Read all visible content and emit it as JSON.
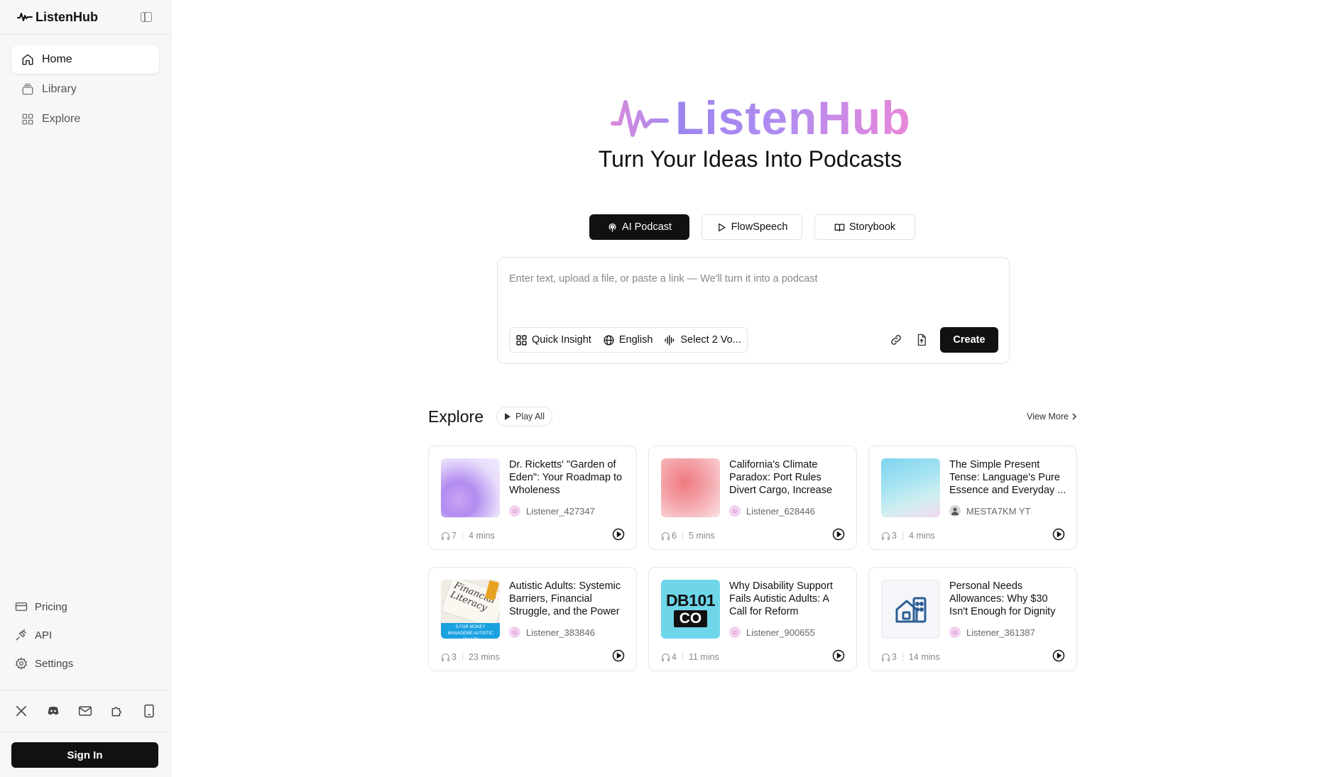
{
  "app": {
    "name": "ListenHub"
  },
  "sidebar": {
    "nav": [
      {
        "label": "Home",
        "icon": "home-icon",
        "active": true
      },
      {
        "label": "Library",
        "icon": "library-icon",
        "active": false
      },
      {
        "label": "Explore",
        "icon": "grid-icon",
        "active": false
      }
    ],
    "bottom": [
      {
        "label": "Pricing",
        "icon": "card-icon"
      },
      {
        "label": "API",
        "icon": "plug-icon"
      },
      {
        "label": "Settings",
        "icon": "gear-icon"
      }
    ],
    "socials": [
      "x-icon",
      "discord-icon",
      "mail-icon",
      "puzzle-icon",
      "tablet-icon"
    ],
    "sign_in": "Sign In"
  },
  "hero": {
    "logo_text": "ListenHub",
    "title": "Turn Your Ideas Into Podcasts"
  },
  "modes": [
    {
      "label": "AI Podcast",
      "icon": "podcast-icon",
      "active": true
    },
    {
      "label": "FlowSpeech",
      "icon": "play-icon",
      "active": false
    },
    {
      "label": "Storybook",
      "icon": "book-icon",
      "active": false
    }
  ],
  "composer": {
    "placeholder": "Enter text, upload a file, or paste a link — We'll turn it into a podcast",
    "options": [
      {
        "label": "Quick Insight",
        "icon": "grid-icon"
      },
      {
        "label": "English",
        "icon": "globe-icon"
      },
      {
        "label": "Select 2 Vo...",
        "icon": "waveform-icon"
      }
    ],
    "create": "Create"
  },
  "explore": {
    "title": "Explore",
    "play_all": "Play All",
    "view_more": "View More",
    "cards": [
      {
        "title": "Dr. Ricketts' \"Garden of Eden\": Your Roadmap to Wholeness",
        "author": "Listener_427347",
        "listens": "7",
        "duration": "4 mins",
        "thumb": "purple"
      },
      {
        "title": "California's Climate Paradox: Port Rules Divert Cargo, Increase GHG ...",
        "author": "Listener_628446",
        "listens": "6",
        "duration": "5 mins",
        "thumb": "red"
      },
      {
        "title": "The Simple Present Tense: Language's Pure Essence and Everyday ...",
        "author": "MESTA7KM YT",
        "listens": "3",
        "duration": "4 mins",
        "thumb": "blue"
      },
      {
        "title": "Autistic Adults: Systemic Barriers, Financial Struggle, and the Power ...",
        "author": "Listener_383846",
        "listens": "3",
        "duration": "23 mins",
        "thumb": "literacy"
      },
      {
        "title": "Why Disability Support Fails Autistic Adults: A Call for Reform",
        "author": "Listener_900655",
        "listens": "4",
        "duration": "11 mins",
        "thumb": "db101"
      },
      {
        "title": "Personal Needs Allowances: Why $30 Isn't Enough for Dignity",
        "author": "Listener_361387",
        "listens": "3",
        "duration": "14 mins",
        "thumb": "house"
      }
    ],
    "thumb_text": {
      "literacy_line1": "Financial",
      "literacy_line2": "Literacy",
      "literacy_caption": "S FOR MONEY MANAGEME AUTISTIC ADULTS",
      "db101_top": "DB101",
      "db101_bottom": "CO"
    }
  }
}
